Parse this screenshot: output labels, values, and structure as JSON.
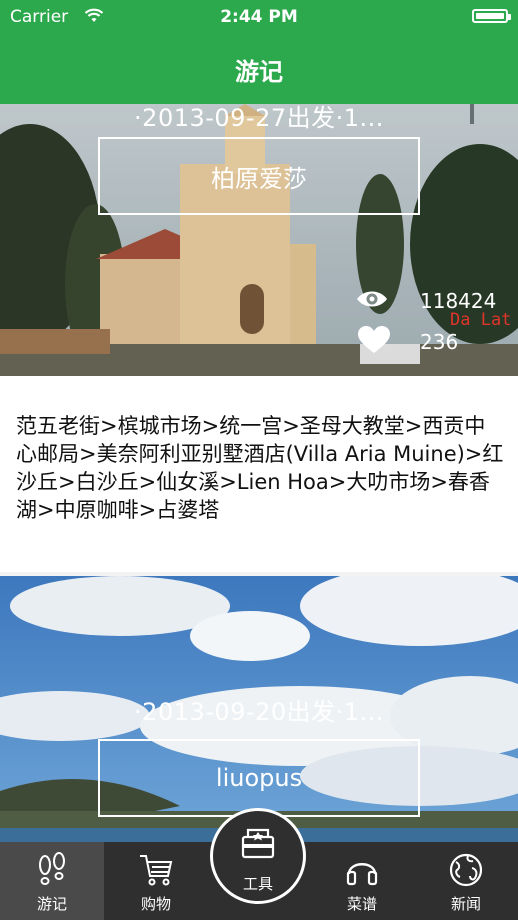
{
  "status_bar": {
    "carrier": "Carrier",
    "time": "2:44 PM"
  },
  "nav": {
    "title": "游记"
  },
  "posts": [
    {
      "meta": "·2013-09-27出发·1...",
      "author": "柏原爱莎",
      "views": "118424",
      "likes": "236",
      "watermark": "Da Lat",
      "description": "范五老街>槟城市场>统一宫>圣母大教堂>西贡中心邮局>美奈阿利亚别墅酒店(Villa Aria Muine)>红沙丘>白沙丘>仙女溪>Lien Hoa>大叻市场>春香湖>中原咖啡>占婆塔"
    },
    {
      "meta": "·2013-09-20出发·1...",
      "author": "liuopus"
    }
  ],
  "tabbar": {
    "tabs": [
      {
        "label": "游记",
        "icon": "footprints-icon",
        "active": true
      },
      {
        "label": "购物",
        "icon": "cart-icon"
      },
      {
        "label": "工具",
        "icon": "toolbox-icon"
      },
      {
        "label": "菜谱",
        "icon": "headphones-icon"
      },
      {
        "label": "新闻",
        "icon": "globe-icon"
      }
    ]
  },
  "colors": {
    "brand_green": "#2da94d",
    "tabbar_bg": "#2f2f2f",
    "tab_active_bg": "#4a4a4a",
    "watermark": "#e0342a"
  }
}
